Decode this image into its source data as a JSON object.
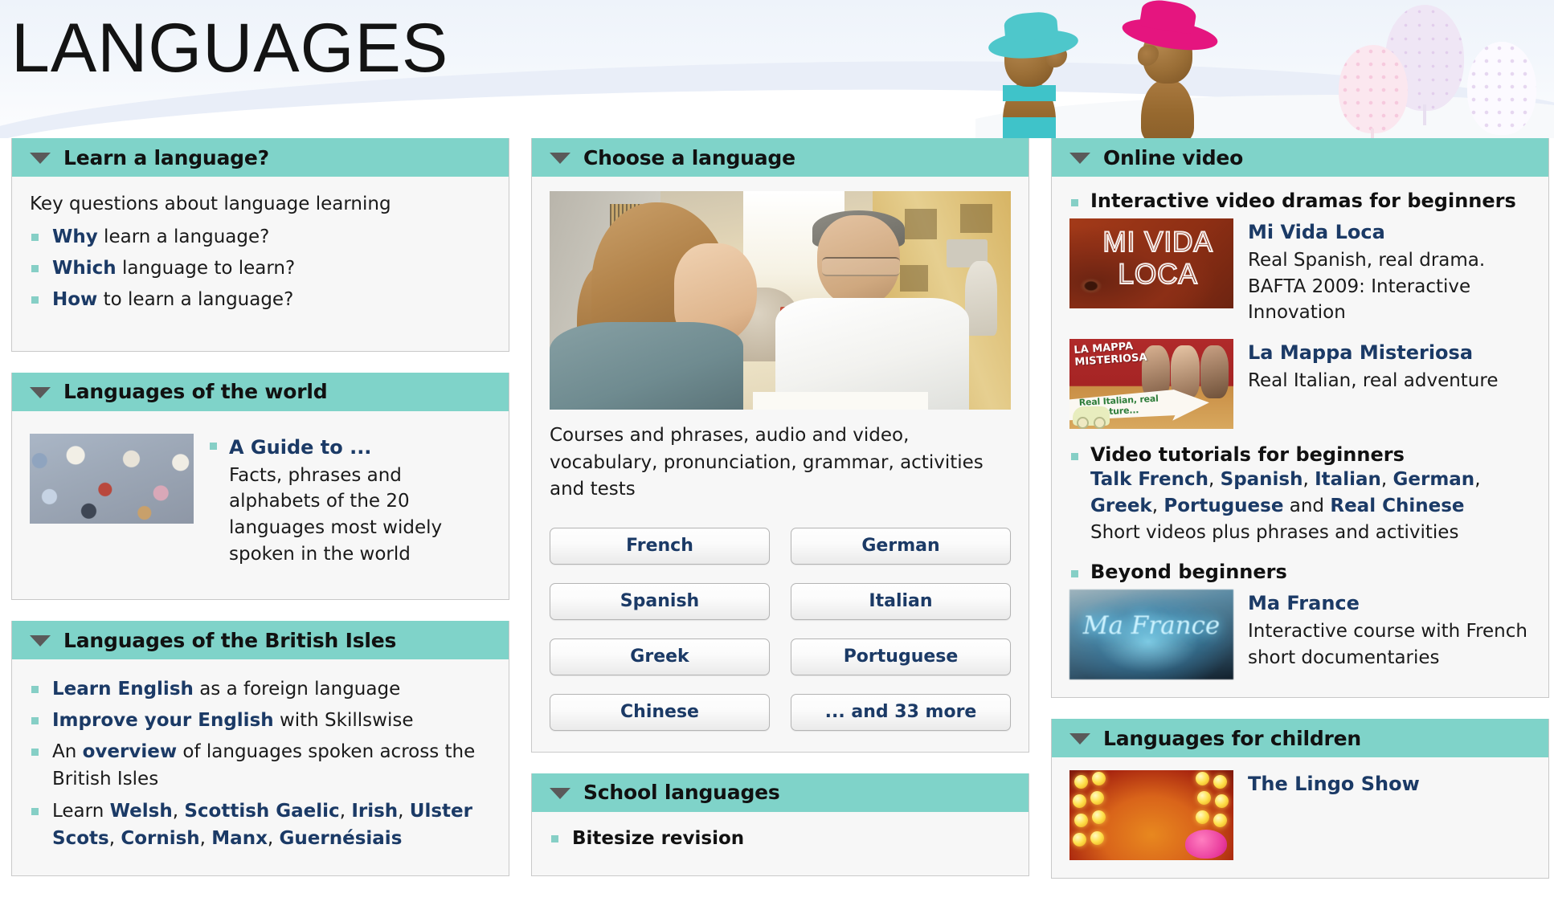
{
  "header": {
    "title": "LANGUAGES",
    "figures": [
      {
        "name": "peg-figure-teal-hat",
        "hat_color": "#3fc3c9",
        "wood_color": "#9a6e36"
      },
      {
        "name": "peg-figure-pink-hat",
        "hat_color": "#e5157f",
        "wood_color": "#9a6e36"
      }
    ],
    "decor": [
      {
        "name": "dotted-tree-pink",
        "color": "#f6d8e4"
      },
      {
        "name": "dotted-tree-lilac",
        "color": "#eee2f2"
      }
    ]
  },
  "panels": {
    "learn_a_language": {
      "title": "Learn a language?",
      "chevron": "chevron-down-icon",
      "intro": "Key questions about language learning",
      "items": [
        {
          "link": "Why",
          "rest": " learn a language?"
        },
        {
          "link": "Which",
          "rest": " language to learn?"
        },
        {
          "link": "How",
          "rest": " to learn a language?"
        }
      ]
    },
    "languages_of_the_world": {
      "title": "Languages of the world",
      "chevron": "chevron-down-icon",
      "thumb_name": "crowd-of-people-thumbnail",
      "link": "A Guide to ...",
      "desc": "Facts, phrases and alphabets of the 20 languages most widely spoken in the world"
    },
    "languages_of_the_british_isles": {
      "title": "Languages of the British Isles",
      "chevron": "chevron-down-icon",
      "items": [
        {
          "link": "Learn English",
          "rest": " as a foreign language"
        },
        {
          "link": "Improve your English",
          "rest": " with Skillswise"
        },
        {
          "pre": "An ",
          "link": "overview",
          "rest": " of languages spoken across the British Isles"
        },
        {
          "pre": "Learn ",
          "links": [
            "Welsh",
            "Scottish Gaelic",
            "Irish",
            "Ulster Scots",
            "Cornish",
            "Manx",
            "Guernésiais"
          ]
        }
      ]
    },
    "choose_a_language": {
      "title": "Choose a language",
      "chevron": "chevron-down-icon",
      "photo_name": "two-people-talking-street-cafe-photo",
      "desc": "Courses and phrases, audio and video, vocabulary, pronunciation, grammar, activities and tests",
      "buttons": [
        "French",
        "German",
        "Spanish",
        "Italian",
        "Greek",
        "Portuguese",
        "Chinese",
        "... and 33 more"
      ]
    },
    "school_languages": {
      "title": "School languages",
      "chevron": "chevron-down-icon",
      "items": [
        {
          "link": "Bitesize revision"
        }
      ]
    },
    "online_video": {
      "title": "Online video",
      "chevron": "chevron-down-icon",
      "groups": [
        {
          "heading": "Interactive video dramas for beginners",
          "media": [
            {
              "thumb_name": "mi-vida-loca-thumbnail",
              "thumb_text_line1": "MI VIDA",
              "thumb_text_line2": "LOCA",
              "title": "Mi Vida Loca",
              "desc": "Real Spanish, real drama. BAFTA 2009: Interactive Innovation"
            },
            {
              "thumb_name": "la-mappa-misteriosa-thumbnail",
              "thumb_title": "LA MAPPA MISTERIOSA",
              "thumb_arrow_text": "Real Italian, real adventure...",
              "title": "La Mappa Misteriosa",
              "desc": "Real Italian, real adventure"
            }
          ]
        },
        {
          "heading": "Video tutorials for beginners",
          "links": [
            "Talk French",
            "Spanish",
            "Italian",
            "German",
            "Greek",
            "Portuguese"
          ],
          "last_link": "Real Chinese",
          "conjunction": " and ",
          "desc": "Short videos plus phrases and activities"
        },
        {
          "heading": "Beyond beginners",
          "media": [
            {
              "thumb_name": "ma-france-thumbnail",
              "thumb_text": "Ma France",
              "title": "Ma France",
              "desc": "Interactive course with French short documentaries"
            }
          ]
        }
      ]
    },
    "languages_for_children": {
      "title": "Languages for children",
      "chevron": "chevron-down-icon",
      "media": [
        {
          "thumb_name": "the-lingo-show-thumbnail",
          "title": "The Lingo Show"
        }
      ]
    }
  },
  "colors": {
    "panel_header_teal": "#7fd3c9",
    "link_navy": "#1b3a66",
    "bullet_teal": "#86cfc6",
    "panel_bg": "#f7f7f7",
    "panel_border": "#c9c9c9"
  }
}
